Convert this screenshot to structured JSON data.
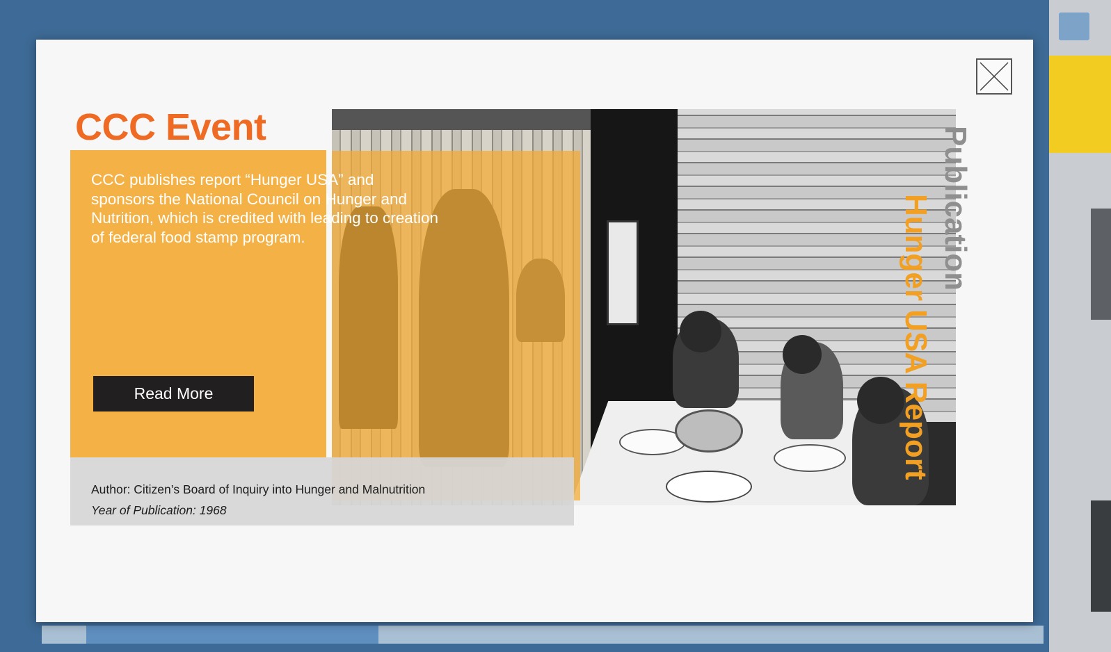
{
  "modal": {
    "title": "CCC Event",
    "description": "CCC publishes report “Hunger USA” and sponsors the National Council on Hunger and Nutrition, which is credited with leading to creation of federal food stamp program.",
    "read_more_label": "Read More",
    "author": "Author: Citizen’s Board of Inquiry into Hunger and Malnutrition",
    "year": "Year of Publication: 1968",
    "category": "Publication",
    "report_name": "Hunger USA Report",
    "close_icon": "close-icon"
  },
  "colors": {
    "title": "#ef6a23",
    "panel": "#f4b146",
    "report_name": "#f2a024",
    "category": "#8f8f8f",
    "button": "#221f20",
    "background": "#3d6a96"
  }
}
